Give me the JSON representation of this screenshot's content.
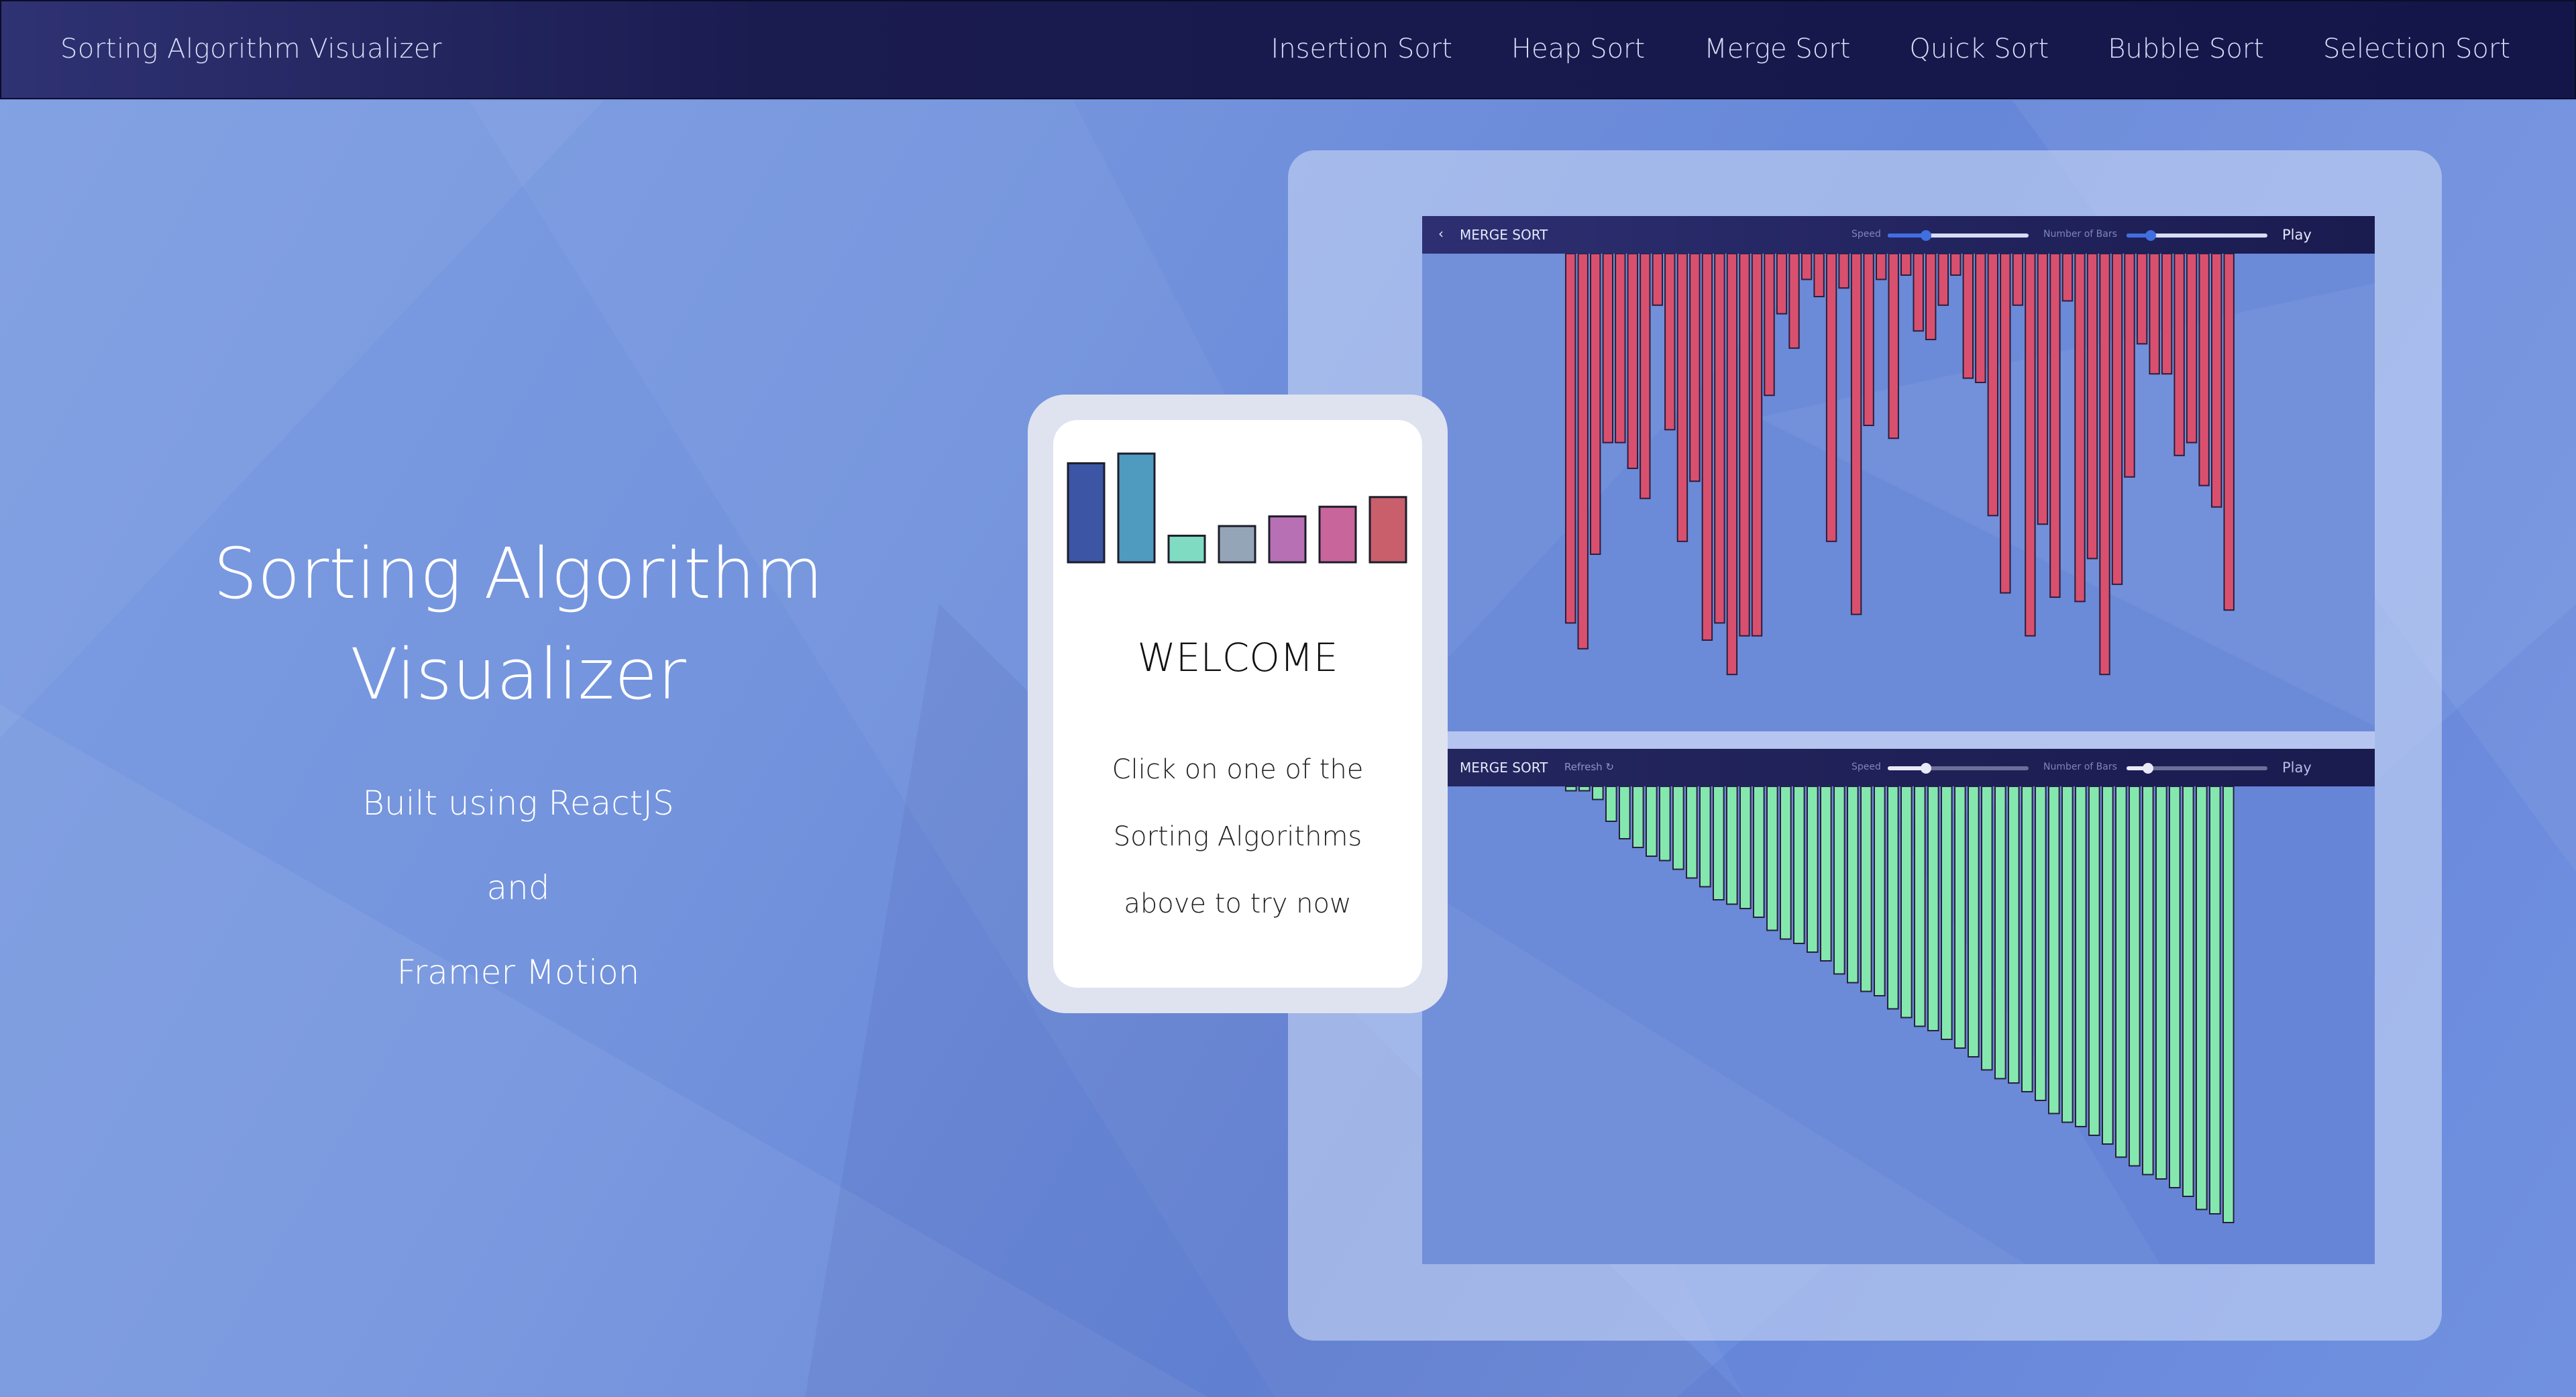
{
  "colors": {
    "nav_bg": "#1a1b4f",
    "page_bg": "#7393dd",
    "bar_red": "#d9506f",
    "bar_green": "#84e8ae",
    "bar_stroke": "#2a1f3d"
  },
  "navbar": {
    "brand": "Sorting Algorithm Visualizer",
    "links": [
      "Insertion Sort",
      "Heap Sort",
      "Merge Sort",
      "Quick Sort",
      "Bubble Sort",
      "Selection Sort"
    ]
  },
  "hero": {
    "title_line1": "Sorting Algorithm",
    "title_line2": "Visualizer",
    "sub1": "Built using ReactJS",
    "sub2": "and",
    "sub3": "Framer Motion"
  },
  "card": {
    "welcome": "WELCOME",
    "line1": "Click on one of the",
    "line2": "Sorting Algorithms",
    "line3": "above to try now",
    "bar_values": [
      0.82,
      0.9,
      0.22,
      0.3,
      0.38,
      0.46,
      0.54
    ],
    "bar_colors": [
      "#3c55a5",
      "#4f9bbf",
      "#7fdcc2",
      "#95a5b8",
      "#b870b4",
      "#c8659b",
      "#c95f6b"
    ]
  },
  "viz_top": {
    "back_icon": "chevron-left-icon",
    "title": "MERGE SORT",
    "speed_label": "Speed",
    "bars_label": "Number of Bars",
    "play_label": "Play",
    "speed_value": 0.27,
    "bars_value": 0.17,
    "bar_values": [
      0.86,
      0.92,
      0.7,
      0.44,
      0.44,
      0.5,
      0.57,
      0.12,
      0.41,
      0.67,
      0.53,
      0.9,
      0.86,
      0.98,
      0.89,
      0.89,
      0.33,
      0.14,
      0.22,
      0.06,
      0.1,
      0.67,
      0.08,
      0.84,
      0.4,
      0.06,
      0.43,
      0.05,
      0.18,
      0.2,
      0.12,
      0.05,
      0.29,
      0.3,
      0.61,
      0.79,
      0.12,
      0.89,
      0.63,
      0.8,
      0.11,
      0.81,
      0.71,
      0.98,
      0.77,
      0.52,
      0.21,
      0.28,
      0.28,
      0.47,
      0.44,
      0.54,
      0.59,
      0.83
    ]
  },
  "viz_bottom": {
    "title": "MERGE SORT",
    "refresh_label": "Refresh ↻",
    "speed_label": "Speed",
    "bars_label": "Number of Bars",
    "play_label": "Play",
    "speed_value": 0.27,
    "bars_value": 0.15,
    "bar_values": [
      0.01,
      0.01,
      0.03,
      0.08,
      0.12,
      0.14,
      0.16,
      0.17,
      0.19,
      0.21,
      0.23,
      0.26,
      0.27,
      0.28,
      0.3,
      0.33,
      0.35,
      0.36,
      0.38,
      0.4,
      0.43,
      0.45,
      0.47,
      0.48,
      0.51,
      0.53,
      0.55,
      0.56,
      0.58,
      0.6,
      0.62,
      0.65,
      0.67,
      0.68,
      0.7,
      0.72,
      0.75,
      0.77,
      0.78,
      0.8,
      0.82,
      0.85,
      0.87,
      0.89,
      0.9,
      0.92,
      0.94,
      0.97,
      0.98,
      1.0
    ]
  }
}
